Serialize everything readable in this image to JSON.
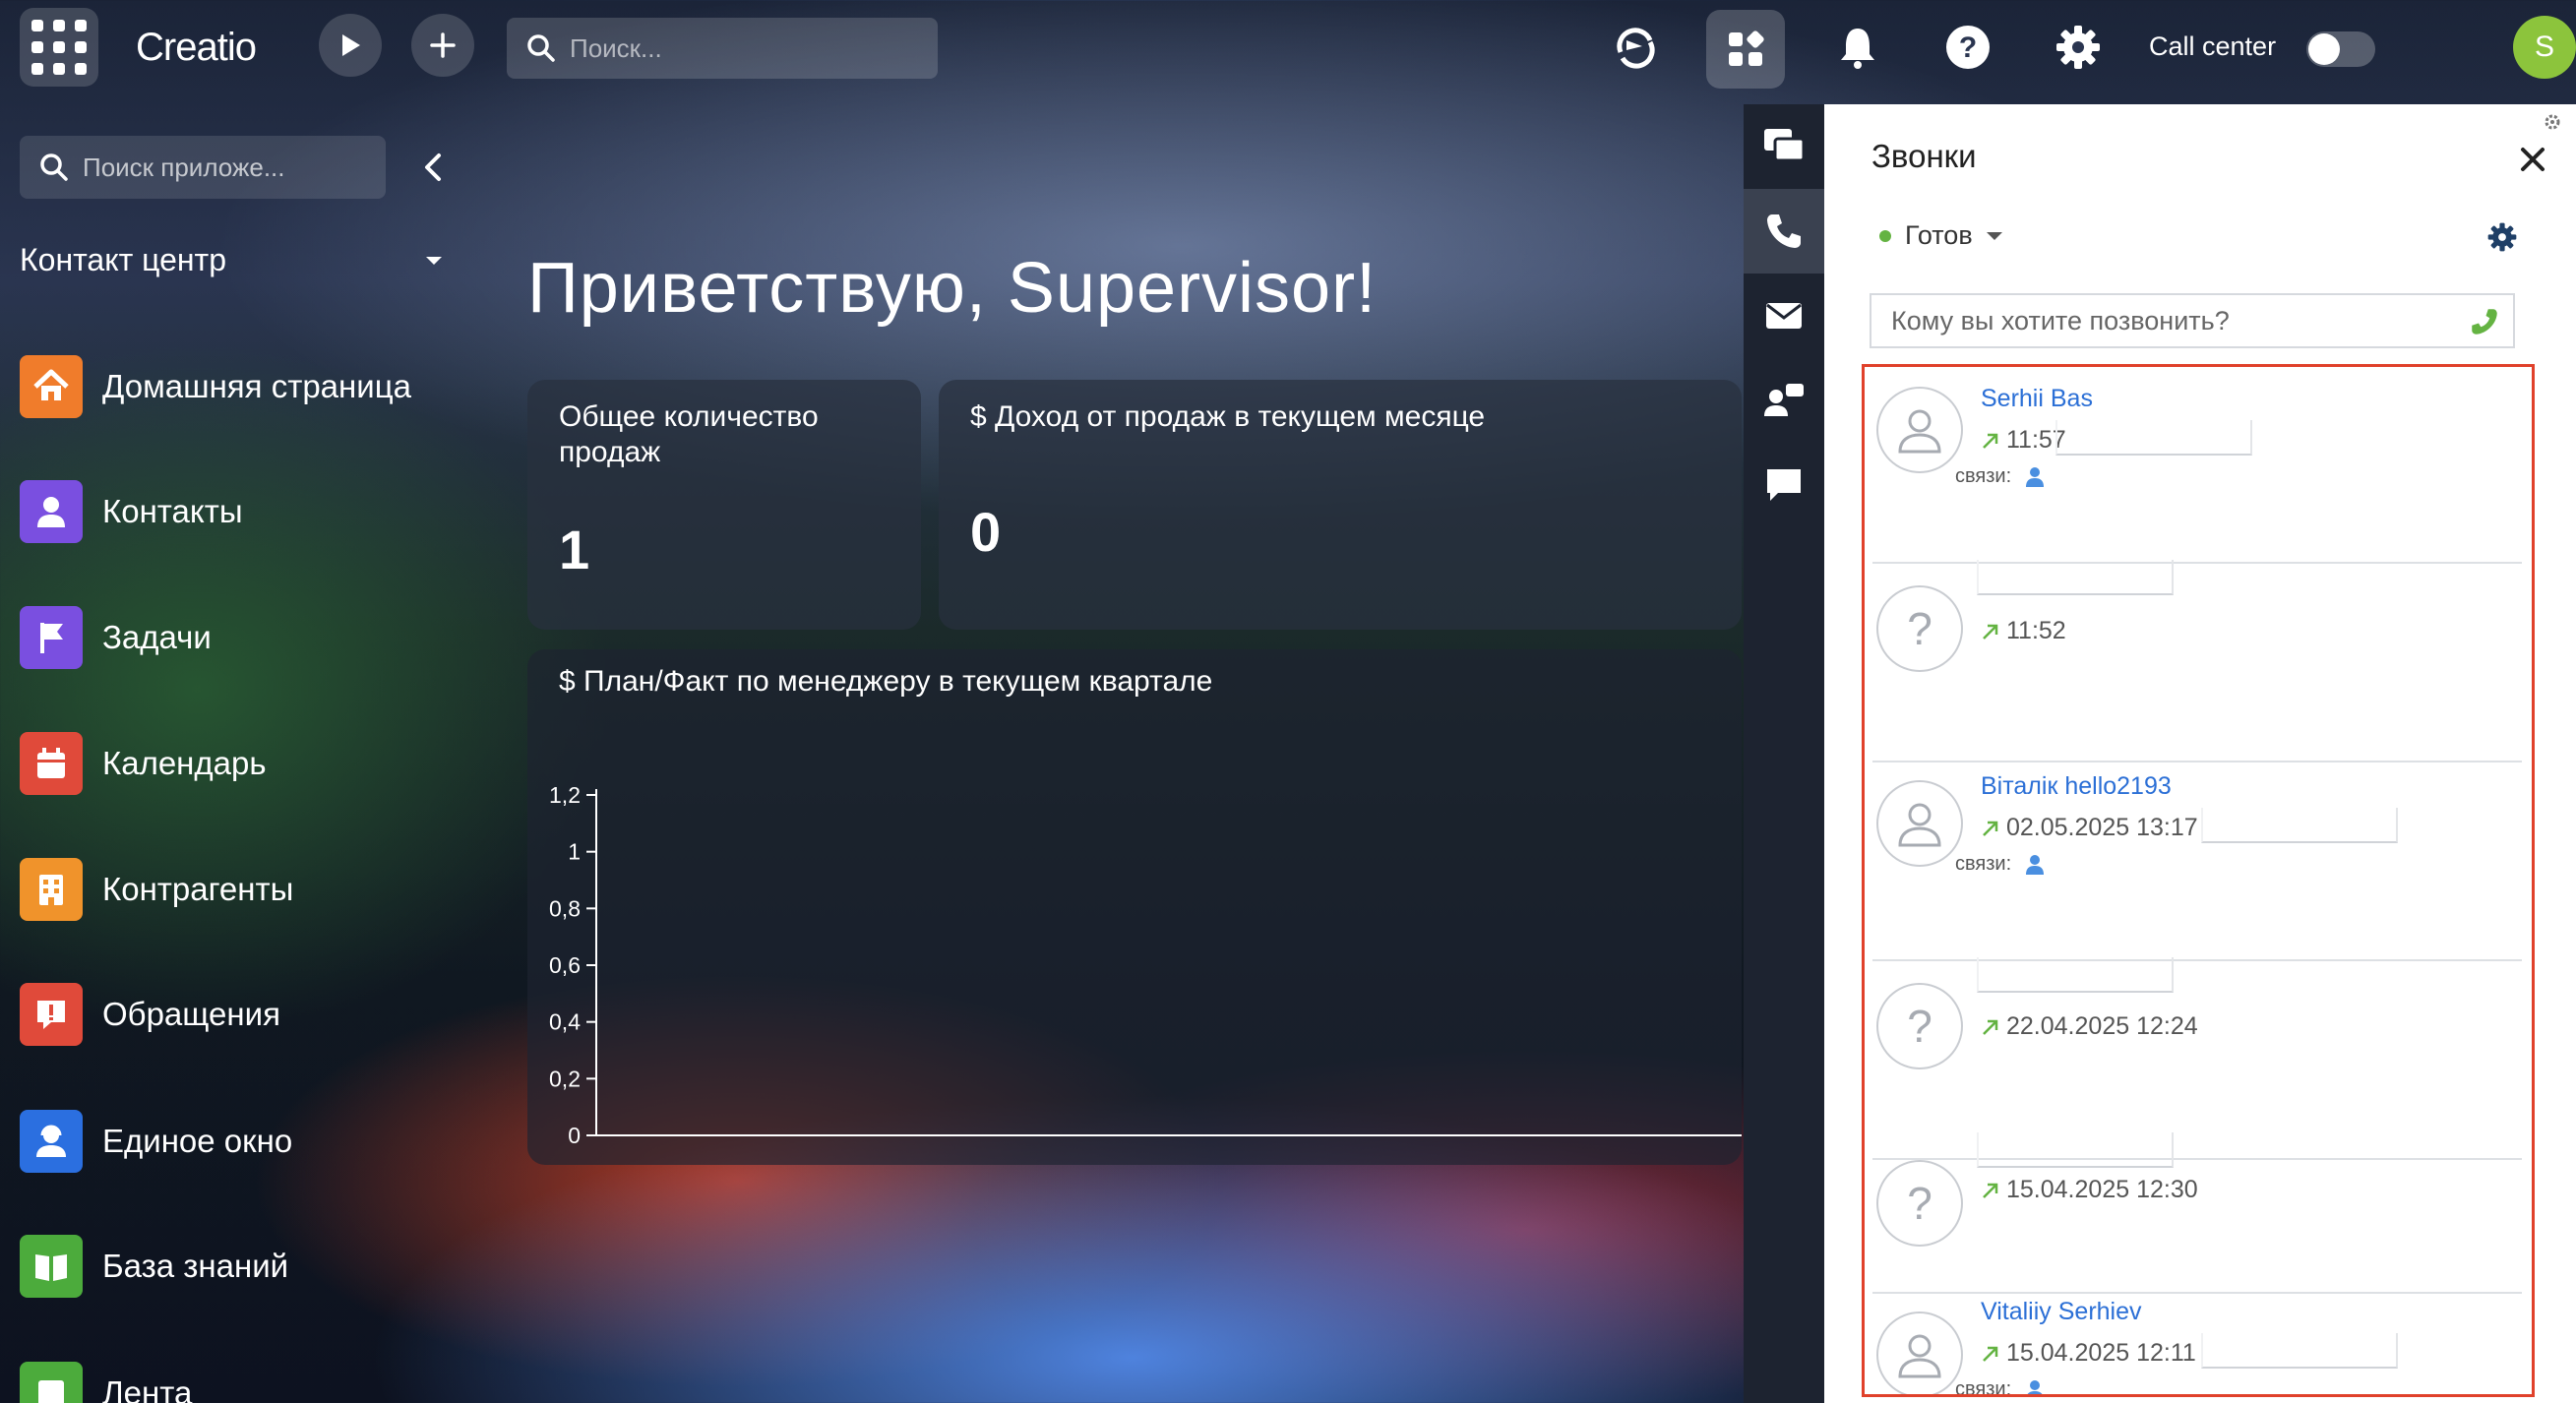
{
  "topbar": {
    "logo": "Creatio",
    "search_placeholder": "Поиск...",
    "call_center_label": "Call center",
    "user_initial": "S"
  },
  "nav": {
    "search_placeholder": "Поиск приложе...",
    "workplace": "Контакт центр",
    "items": [
      {
        "label": "Домашняя страница",
        "icon": "home-icon",
        "color": "#f07c2b"
      },
      {
        "label": "Контакты",
        "icon": "person-icon",
        "color": "#7a4fe0"
      },
      {
        "label": "Задачи",
        "icon": "flag-icon",
        "color": "#7a4fe0"
      },
      {
        "label": "Календарь",
        "icon": "calendar-icon",
        "color": "#e04a3a"
      },
      {
        "label": "Контрагенты",
        "icon": "building-icon",
        "color": "#f0932b"
      },
      {
        "label": "Обращения",
        "icon": "alert-icon",
        "color": "#e04a3a"
      },
      {
        "label": "Единое окно",
        "icon": "agent-icon",
        "color": "#2b6fe0"
      },
      {
        "label": "База знаний",
        "icon": "book-icon",
        "color": "#4cab3c"
      },
      {
        "label": "Лента",
        "icon": "feed-icon",
        "color": "#4cab3c"
      }
    ]
  },
  "dashboard": {
    "greeting": "Приветствую, Supervisor!",
    "total_sales": {
      "title_line1": "Общее количество",
      "title_line2": "продаж",
      "value": "1"
    },
    "revenue": {
      "title": "$ Доход от продаж в текущем месяце",
      "value": "0"
    },
    "plan_fact": {
      "title": "$ План/Факт по менеджеру в текущем квартале"
    }
  },
  "chart_data": {
    "type": "bar",
    "title": "$ План/Факт по менеджеру в текущем квартале",
    "categories": [],
    "values": [],
    "ylim": [
      0,
      1.2
    ],
    "yticks": [
      "0",
      "0,2",
      "0,4",
      "0,6",
      "0,8",
      "1",
      "1,2"
    ],
    "grid": false
  },
  "calls_panel": {
    "title": "Звонки",
    "status": "Готов",
    "status_color": "#64b342",
    "dial_placeholder": "Кому вы хотите позвонить?",
    "links_label": "связи:",
    "highlight_color": "#e0412b",
    "calls": [
      {
        "name": "Serhii Bas",
        "time": "11:57",
        "known": true
      },
      {
        "name": "",
        "time": "11:52",
        "known": false
      },
      {
        "name": "Віталік hello2193",
        "time": "02.05.2025 13:17",
        "known": true
      },
      {
        "name": "",
        "time": "22.04.2025 12:24",
        "known": false
      },
      {
        "name": "",
        "time": "15.04.2025 12:30",
        "known": false
      },
      {
        "name": "Vitaliiy Serhiev",
        "time": "15.04.2025 12:11",
        "known": true
      }
    ]
  }
}
